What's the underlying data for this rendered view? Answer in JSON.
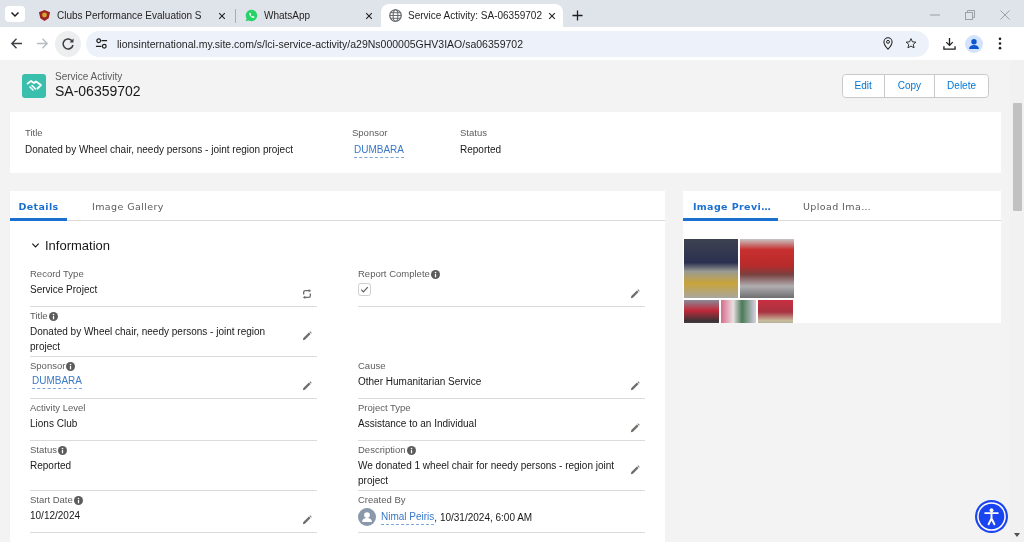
{
  "browser": {
    "tabs": [
      {
        "title": "Clubs Performance Evaluation S",
        "kind": "club",
        "selected": false
      },
      {
        "title": "WhatsApp",
        "kind": "chat",
        "selected": false
      },
      {
        "title": "Service Activity: SA-06359702",
        "kind": "site",
        "selected": true
      }
    ],
    "url": "lionsinternational.my.site.com/s/lci-service-activity/a29Ns000005GHV3IAO/sa06359702",
    "forward_disabled": true
  },
  "header": {
    "object_type": "Service Activity",
    "record_name": "SA-06359702",
    "actions": [
      "Edit",
      "Copy",
      "Delete"
    ]
  },
  "highlights": [
    {
      "label": "Title",
      "value": "Donated by Wheel chair, needy persons - joint region project",
      "kind": "text"
    },
    {
      "label": "Sponsor",
      "value": "DUMBARA",
      "kind": "link"
    },
    {
      "label": "Status",
      "value": "Reported",
      "kind": "text"
    }
  ],
  "details": {
    "tabs": [
      {
        "label": "Details",
        "selected": true
      },
      {
        "label": "Image Gallery",
        "selected": false
      }
    ],
    "section": {
      "title": "Information",
      "expanded": true
    },
    "rows": [
      [
        {
          "label": "Record Type",
          "info": false,
          "kind": "record_type",
          "value": "Service Project",
          "editable": false
        },
        {
          "label": "Report Complete",
          "info": true,
          "kind": "checkbox",
          "checked": true,
          "editable": true
        }
      ],
      [
        {
          "label": "Title",
          "info": true,
          "kind": "text",
          "value": "Donated by Wheel chair, needy persons - joint region project",
          "editable": true
        }
      ],
      [
        {
          "label": "Sponsor",
          "info": true,
          "kind": "link",
          "value": "DUMBARA",
          "editable": true
        },
        {
          "label": "Cause",
          "info": false,
          "kind": "text",
          "value": "Other Humanitarian Service",
          "editable": true
        }
      ],
      [
        {
          "label": "Activity Level",
          "info": false,
          "kind": "text",
          "value": "Lions Club",
          "editable": false
        },
        {
          "label": "Project Type",
          "info": false,
          "kind": "text",
          "value": "Assistance to an Individual",
          "editable": true
        }
      ],
      [
        {
          "label": "Status",
          "info": true,
          "kind": "text",
          "value": "Reported",
          "editable": false
        },
        {
          "label": "Description",
          "info": true,
          "kind": "text",
          "value": "We donated 1 wheel chair for needy persons - region joint project",
          "editable": true
        }
      ],
      [
        {
          "label": "Start Date",
          "info": true,
          "kind": "text",
          "value": "10/12/2024",
          "editable": true
        },
        {
          "label": "Created By",
          "info": false,
          "kind": "user",
          "value": "Nimal Peiris",
          "suffix": ", 10/31/2024, 6:00 AM",
          "editable": false
        }
      ]
    ]
  },
  "image_panel": {
    "tabs": [
      {
        "label": "Image Previ…",
        "selected": true
      },
      {
        "label": "Upload Ima…",
        "selected": false
      }
    ]
  }
}
